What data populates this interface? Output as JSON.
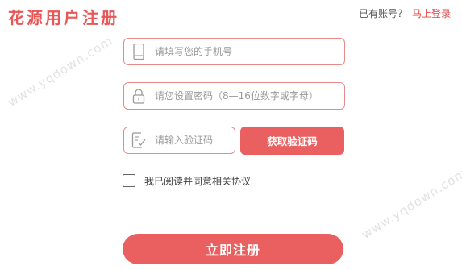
{
  "header": {
    "brand": "花源用户注册",
    "login_prompt": "已有账号？",
    "login_link": "马上登录"
  },
  "form": {
    "phone": {
      "placeholder": "请填写您的手机号",
      "icon": "phone-icon"
    },
    "password": {
      "placeholder": "请您设置密码（8—16位数字或字母）",
      "icon": "lock-icon"
    },
    "code": {
      "placeholder": "请输入验证码",
      "icon": "verify-code-icon"
    },
    "get_code_label": "获取验证码",
    "agree_label": "我已阅读并同意相关协议",
    "submit_label": "立即注册"
  },
  "watermark": "www.yqdown.com",
  "colors": {
    "accent": "#ea5f5f",
    "field_border": "#e88a8a",
    "link": "#e04343"
  }
}
